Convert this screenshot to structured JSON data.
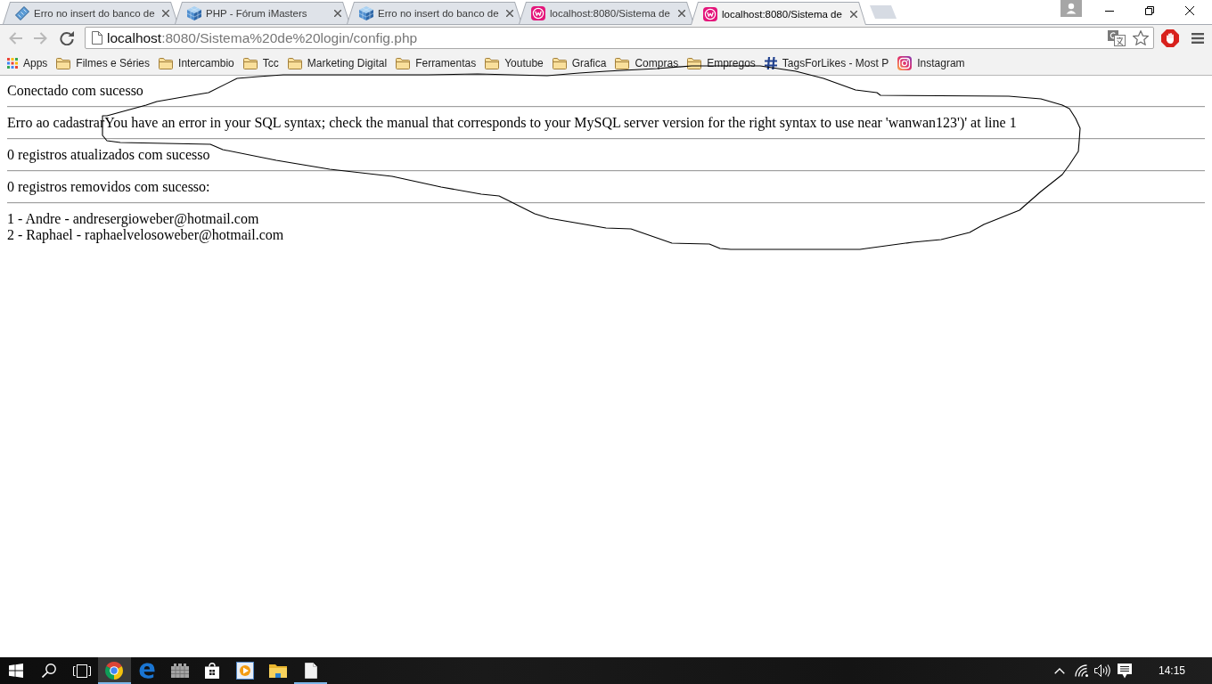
{
  "tabs": [
    {
      "kind": "chip",
      "title": "Erro no insert do banco de",
      "selected": false
    },
    {
      "kind": "cube",
      "title": "PHP - Fórum iMasters",
      "selected": false
    },
    {
      "kind": "cube",
      "title": "Erro no insert do banco de",
      "selected": false
    },
    {
      "kind": "w",
      "title": "localhost:8080/Sistema de",
      "selected": false
    },
    {
      "kind": "w",
      "title": "localhost:8080/Sistema de",
      "selected": true
    }
  ],
  "navigation": [
    {
      "kind": "back",
      "disabled": true
    },
    {
      "kind": "forward",
      "disabled": true
    },
    {
      "kind": "reload",
      "disabled": false
    }
  ],
  "address_bar": {
    "url": "localhost:8080/Sistema%20de%20login/config.php"
  },
  "bookmarks": [
    {
      "kind": "apps",
      "label": "Apps"
    },
    {
      "kind": "folder",
      "label": "Filmes e Séries"
    },
    {
      "kind": "folder",
      "label": "Intercambio"
    },
    {
      "kind": "folder",
      "label": "Tcc"
    },
    {
      "kind": "folder",
      "label": "Marketing Digital"
    },
    {
      "kind": "folder",
      "label": "Ferramentas"
    },
    {
      "kind": "folder",
      "label": "Youtube"
    },
    {
      "kind": "folder",
      "label": "Grafica"
    },
    {
      "kind": "folder",
      "label": "Compras"
    },
    {
      "kind": "folder",
      "label": "Empregos"
    },
    {
      "kind": "hashtag",
      "label": "TagsForLikes - Most P"
    },
    {
      "kind": "camera",
      "label": "Instagram"
    }
  ],
  "page": {
    "blocks": [
      {
        "lines": [
          "Conectado com sucesso"
        ]
      },
      {
        "lines": [
          "Erro ao cadastrarYou have an error in your SQL syntax; check the manual that corresponds to your MySQL server version for the right syntax to use near 'wanwan123')' at line 1"
        ]
      },
      {
        "lines": [
          "0 registros atualizados com sucesso"
        ]
      },
      {
        "lines": [
          "0 registros removidos com sucesso:"
        ]
      },
      {
        "lines": [
          "1 - Andre - andresergioweber@hotmail.com",
          "2 - Raphael - raphaelvelosoweber@hotmail.com"
        ]
      }
    ]
  },
  "annotations": [
    {
      "kind": "freehand-loop"
    }
  ],
  "taskbar": {
    "apps": [
      {
        "kind": "chrome",
        "running": true,
        "selected": true
      },
      {
        "kind": "edge",
        "running": false,
        "selected": false
      },
      {
        "kind": "castle",
        "running": false,
        "selected": false
      },
      {
        "kind": "store",
        "running": false,
        "selected": false
      },
      {
        "kind": "player",
        "running": false,
        "selected": false
      },
      {
        "kind": "explorer",
        "running": false,
        "selected": false
      },
      {
        "kind": "document",
        "running": true,
        "selected": false
      }
    ],
    "clock": "14:15"
  }
}
